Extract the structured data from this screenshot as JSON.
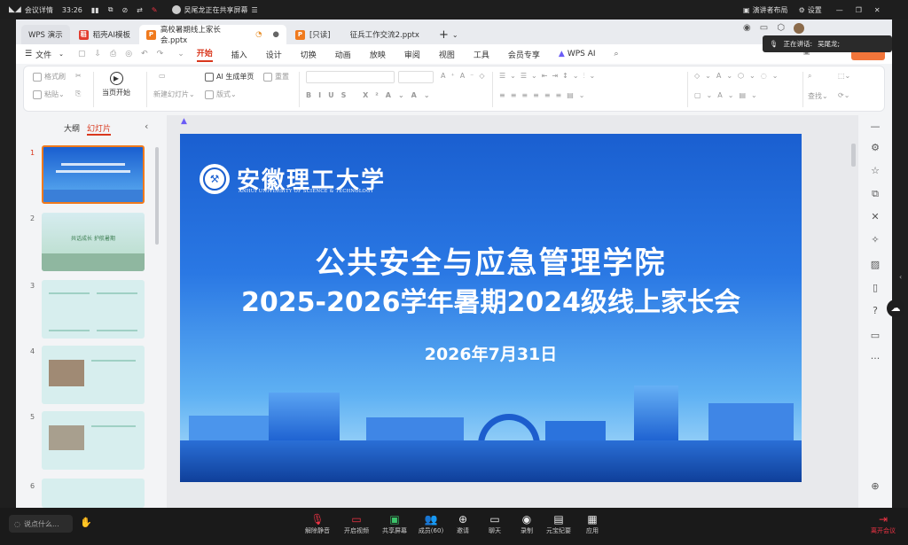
{
  "meeting": {
    "details": "会议详情",
    "timer": "33:26",
    "share_notice": "吴尾龙正在共享屏幕",
    "layout": "演讲者布局",
    "settings": "设置",
    "speaker_label": "正在讲话:",
    "speaker_name": "吴尾龙;",
    "chat_placeholder": "说点什么...",
    "toolbar": [
      {
        "label": "解除静音",
        "icon": "mic-muted-icon"
      },
      {
        "label": "开启视频",
        "icon": "camera-off-icon"
      },
      {
        "label": "共享屏幕",
        "icon": "share-screen-icon"
      },
      {
        "label": "成员(60)",
        "icon": "members-icon"
      },
      {
        "label": "邀请",
        "icon": "invite-icon"
      },
      {
        "label": "聊天",
        "icon": "chat-icon"
      },
      {
        "label": "录制",
        "icon": "record-icon"
      },
      {
        "label": "元宝纪要",
        "icon": "notes-icon"
      },
      {
        "label": "应用",
        "icon": "apps-icon"
      }
    ],
    "leave": "离开会议"
  },
  "tabs": [
    {
      "label": "WPS 演示",
      "color": "#ffffff"
    },
    {
      "label": "稻壳AI模板",
      "color": "#e23b2e"
    },
    {
      "label": "高校暑期线上家长会.pptx",
      "color": "#f07a1d"
    },
    {
      "label": "[只读]",
      "color": "#f07a1d"
    },
    {
      "label": "征兵工作交流2.pptx",
      "color": ""
    }
  ],
  "menu": [
    "文件",
    "开始",
    "插入",
    "设计",
    "切换",
    "动画",
    "放映",
    "审阅",
    "视图",
    "工具",
    "会员专享",
    "WPS AI"
  ],
  "ribbon": {
    "format_painter": "格式刷",
    "paste": "粘贴",
    "from_first": "当页开始",
    "new_slide": "新建幻灯片",
    "ai_gen": "AI 生成单页",
    "layout": "版式",
    "reset": "重置",
    "find": "查找"
  },
  "pane": {
    "outline": "大纲",
    "slides": "幻灯片",
    "numbers": [
      "1",
      "2",
      "3",
      "4",
      "5",
      "6"
    ],
    "thumb2_text": "共话成长 护航暑期"
  },
  "slide": {
    "logo_cn": "安徽理工大学",
    "logo_en": "ANHUI UNIVERSITY OF SCIENCE & TECHNOLOGY",
    "title1": "公共安全与应急管理学院",
    "title2": "2025-2026学年暑期2024级线上家长会",
    "date": "2026年7月31日"
  },
  "colors": {
    "accent": "#d9381e",
    "slide_blue": "#1a5fd0"
  }
}
